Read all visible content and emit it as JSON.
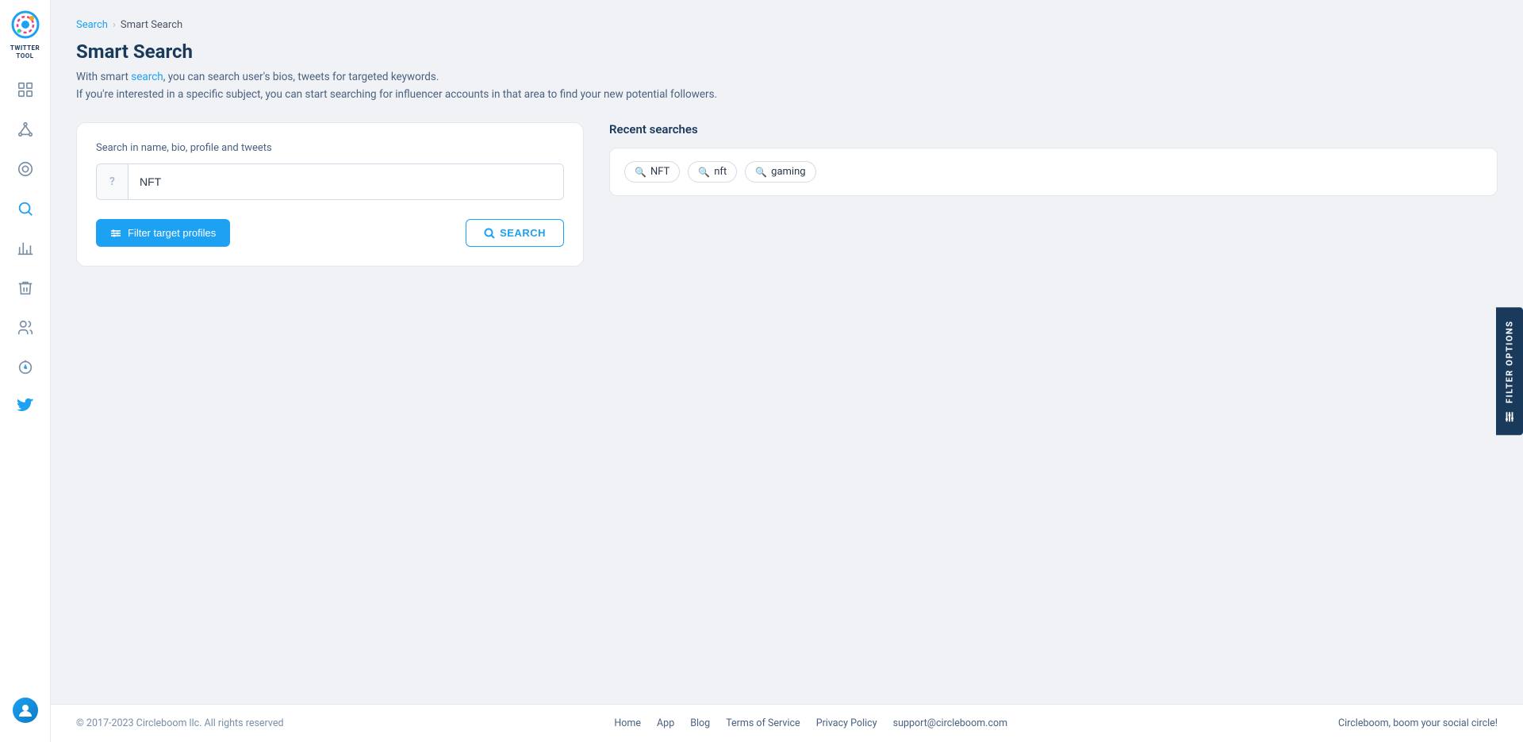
{
  "app": {
    "name": "TWITTER TOOL",
    "name_line1": "TWITTER",
    "name_line2": "TOOL"
  },
  "sidebar": {
    "items": [
      {
        "id": "dashboard",
        "icon": "grid",
        "label": "Dashboard"
      },
      {
        "id": "network",
        "icon": "network",
        "label": "Network"
      },
      {
        "id": "circle",
        "icon": "circle",
        "label": "Circle"
      },
      {
        "id": "search",
        "icon": "search",
        "label": "Search",
        "active": true
      },
      {
        "id": "analytics",
        "icon": "bar-chart",
        "label": "Analytics"
      },
      {
        "id": "cleanup",
        "icon": "trash",
        "label": "Cleanup"
      },
      {
        "id": "users",
        "icon": "users",
        "label": "Users"
      },
      {
        "id": "boost",
        "icon": "boost",
        "label": "Boost"
      },
      {
        "id": "twitter",
        "icon": "twitter",
        "label": "Twitter"
      }
    ]
  },
  "breadcrumb": {
    "items": [
      {
        "label": "Search",
        "link": true
      },
      {
        "label": "Smart Search",
        "link": false
      }
    ]
  },
  "page": {
    "title": "Smart Search",
    "description_line1": "With smart search, you can search user's bios, tweets for targeted keywords.",
    "description_line2": "If you're interested in a specific subject, you can start searching for influencer accounts in that area to find your new potential followers.",
    "description_highlight": "search"
  },
  "search": {
    "panel_label": "Search in name, bio, profile and tweets",
    "input_placeholder": "NFT",
    "input_value": "NFT",
    "input_icon": "?",
    "filter_button_label": "Filter target profiles",
    "search_button_label": "SEARCH"
  },
  "recent_searches": {
    "title": "Recent searches",
    "items": [
      {
        "label": "NFT"
      },
      {
        "label": "nft"
      },
      {
        "label": "gaming"
      }
    ]
  },
  "filter_options_tab": {
    "label": "FILTER OPTIONS"
  },
  "footer": {
    "copyright": "© 2017-2023 Circleboom llc. All rights reserved",
    "links": [
      {
        "label": "Home"
      },
      {
        "label": "App"
      },
      {
        "label": "Blog"
      },
      {
        "label": "Terms of Service"
      },
      {
        "label": "Privacy Policy"
      },
      {
        "label": "support@circleboom.com"
      }
    ],
    "tagline": "Circleboom, boom your social circle!"
  }
}
